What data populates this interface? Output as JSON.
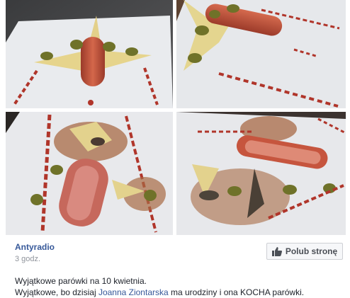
{
  "post": {
    "page_name": "Antyradio",
    "timestamp": "3 godz.",
    "like_button_label": "Polub stronę",
    "text_line1": "Wyjątkowe parówki na 10 kwietnia.",
    "text_line2_before": "Wyjątkowe, bo dzisiaj ",
    "text_line2_mention": "Joanna Ziontarska",
    "text_line2_after": " ma urodziny i ona KOCHA parówki."
  },
  "photos": [
    {
      "name": "photo-sausage-plane-front"
    },
    {
      "name": "photo-sausage-plane-side"
    },
    {
      "name": "photo-cut-sausage-plate-1"
    },
    {
      "name": "photo-cut-sausage-plate-2"
    }
  ],
  "colors": {
    "link": "#365899",
    "meta": "#90949c",
    "text": "#1d2129",
    "sausage": "#c2553e",
    "ketchup": "#b0352a",
    "olive": "#7a7d2e",
    "cheese": "#e8d98f",
    "plate": "#eceef1"
  },
  "icons": {
    "like_button": "thumbs-up-icon"
  }
}
